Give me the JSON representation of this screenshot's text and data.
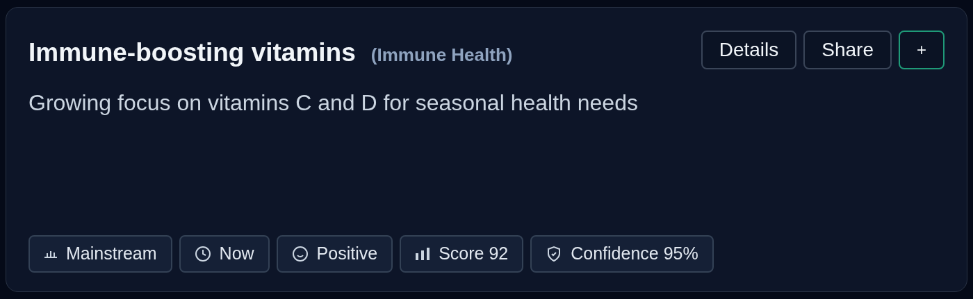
{
  "card": {
    "title": "Immune-boosting vitamins",
    "category": "(Immune Health)",
    "description": "Growing focus on vitamins C and D for seasonal health needs",
    "actions": [
      {
        "kind": "text",
        "label": "Details"
      },
      {
        "kind": "text",
        "label": "Share"
      },
      {
        "kind": "accent",
        "label": "+"
      }
    ],
    "tags": [
      {
        "kind": "stage",
        "label": "Mainstream"
      },
      {
        "kind": "time",
        "label": "Now"
      },
      {
        "kind": "sentiment",
        "label": "Positive"
      },
      {
        "kind": "score",
        "label": "Score 92"
      },
      {
        "kind": "confidence",
        "label": "Confidence 95%"
      }
    ]
  }
}
